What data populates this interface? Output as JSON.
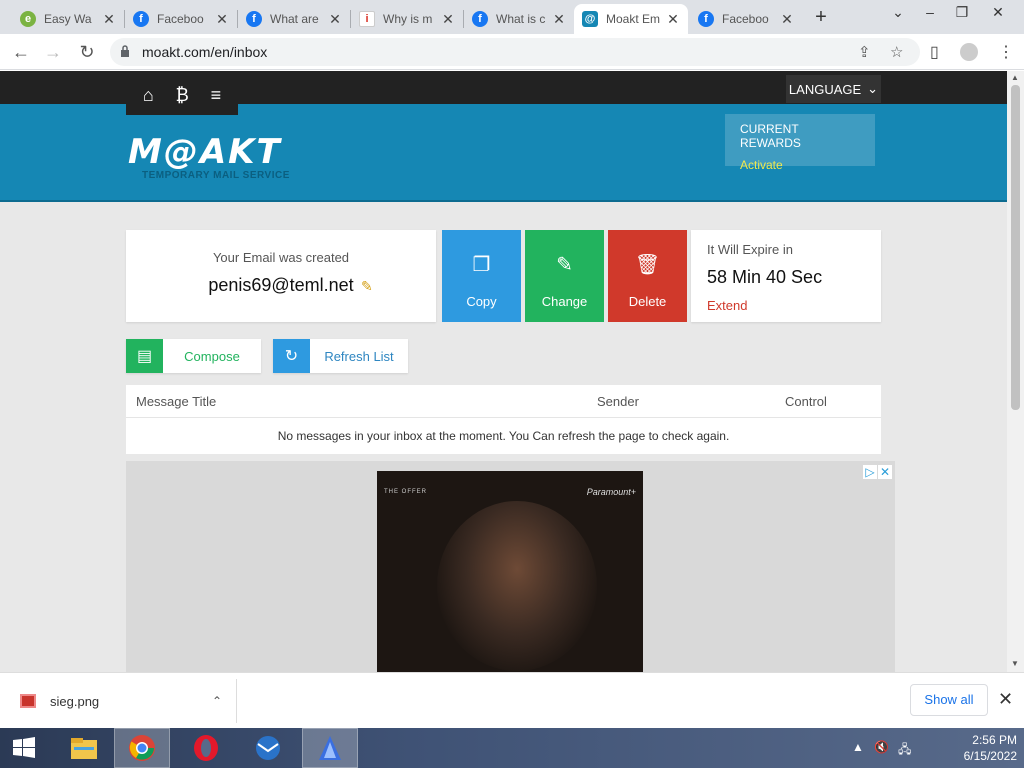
{
  "browser": {
    "tabs": [
      {
        "title": "Easy Wa",
        "favicon": "easy-favicon",
        "color": "#7bb342"
      },
      {
        "title": "Faceboo",
        "favicon": "facebook-favicon",
        "color": "#1877f2"
      },
      {
        "title": "What are",
        "favicon": "facebook-favicon",
        "color": "#1877f2"
      },
      {
        "title": "Why is m",
        "favicon": "info-favicon",
        "color": "#d93025"
      },
      {
        "title": "What is c",
        "favicon": "facebook-favicon",
        "color": "#1877f2"
      },
      {
        "title": "Moakt Em",
        "favicon": "moakt-favicon",
        "color": "#1587b4"
      },
      {
        "title": "Faceboo",
        "favicon": "facebook-favicon",
        "color": "#1877f2"
      }
    ],
    "active_tab_index": 5,
    "url": "moakt.com/en/inbox"
  },
  "site": {
    "language_label": "LANGUAGE",
    "logo_text": "M@AKT",
    "logo_subtitle": "TEMPORARY MAIL SERVICE",
    "rewards": {
      "title": "CURRENT REWARDS",
      "action": "Activate"
    }
  },
  "email_card": {
    "label": "Your Email was created",
    "address": "penis69@teml.net"
  },
  "actions": {
    "copy": "Copy",
    "change": "Change",
    "delete": "Delete"
  },
  "expiry": {
    "label": "It Will Expire in",
    "time": "58 Min 40 Sec",
    "extend": "Extend"
  },
  "toolbar": {
    "compose": "Compose",
    "refresh": "Refresh List"
  },
  "inbox": {
    "columns": [
      "Message Title",
      "Sender",
      "Control"
    ],
    "empty_message": "No messages in your inbox at the moment. You Can refresh the page to check again."
  },
  "ad": {
    "caption_left": "THE OFFER",
    "caption_right": "Paramount+"
  },
  "downloads": {
    "file_name": "sieg.png",
    "show_all": "Show all"
  },
  "taskbar": {
    "time": "2:56 PM",
    "date": "6/15/2022"
  },
  "colors": {
    "brand": "#1587b4",
    "copy": "#2e9ae0",
    "change": "#22b35e",
    "delete": "#d0392b",
    "refresh": "#2e9ae0"
  }
}
